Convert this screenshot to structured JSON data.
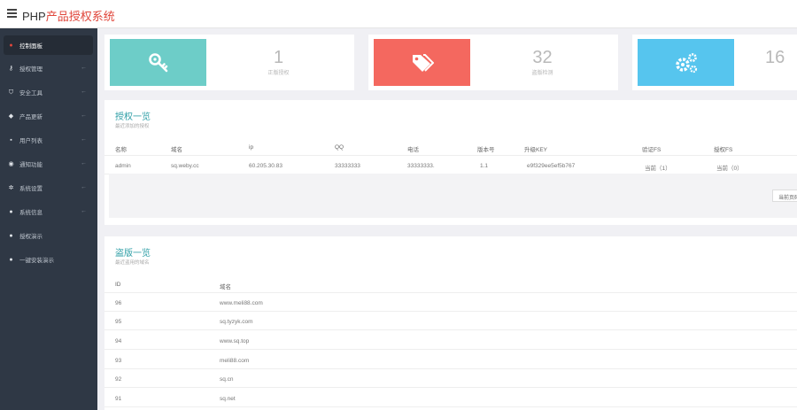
{
  "app": {
    "title_prefix": "PHP",
    "title_accent": "产品授权系统"
  },
  "sidebar": {
    "items": [
      {
        "label": "控制面板",
        "icon": "dashboard-icon",
        "glyph": "●"
      },
      {
        "label": "授权管理",
        "icon": "key-icon",
        "glyph": "⚷"
      },
      {
        "label": "安全工具",
        "icon": "shield-icon",
        "glyph": "⛉"
      },
      {
        "label": "产品更新",
        "icon": "tag-icon",
        "glyph": "◆"
      },
      {
        "label": "用户列表",
        "icon": "user-icon",
        "glyph": "▪"
      },
      {
        "label": "通知功能",
        "icon": "bell-icon",
        "glyph": "◉"
      },
      {
        "label": "系统设置",
        "icon": "gears-icon",
        "glyph": "✲"
      },
      {
        "label": "系统信息",
        "icon": "info-icon",
        "glyph": "●"
      },
      {
        "label": "授权演示",
        "icon": "play-icon",
        "glyph": "●"
      },
      {
        "label": "一键安装演示",
        "icon": "help-icon",
        "glyph": "●"
      }
    ]
  },
  "stats": [
    {
      "value": "1",
      "label": "正版授权",
      "icon": "key-icon",
      "color": "#6dcdc8"
    },
    {
      "value": "32",
      "label": "盗版检测",
      "icon": "tags-icon",
      "color": "#f4685f"
    },
    {
      "value": "16",
      "label": "",
      "icon": "gears-icon",
      "color": "#56c5ee"
    }
  ],
  "auth_panel": {
    "title": "授权一览",
    "subtitle": "最近添加的授权",
    "columns": [
      "名称",
      "域名",
      "ip",
      "QQ",
      "电话",
      "版本号",
      "升级KEY",
      "验证FS",
      "授权FS"
    ],
    "rows": [
      [
        "admin",
        "sq.weby.cc",
        "60.205.30.83",
        "33333333",
        "33333333.",
        "1.1",
        "e9f329ee5ef5b767",
        "当前（1）",
        "当前（0）"
      ]
    ],
    "page_button": "当前页码"
  },
  "pirate_panel": {
    "title": "盗版一览",
    "subtitle": "最近盗用的域名",
    "columns": [
      "ID",
      "域名"
    ],
    "rows": [
      [
        "96",
        "www.meli88.com"
      ],
      [
        "95",
        "sq.tyzyk.com"
      ],
      [
        "94",
        "www.sq.top"
      ],
      [
        "93",
        "meli88.com"
      ],
      [
        "92",
        "sq.cn"
      ],
      [
        "91",
        "sq.net"
      ]
    ]
  },
  "colors": {
    "accent_title": "#2e9ea6",
    "brand_accent": "#e0463b",
    "sidebar_bg": "#2f3845"
  }
}
